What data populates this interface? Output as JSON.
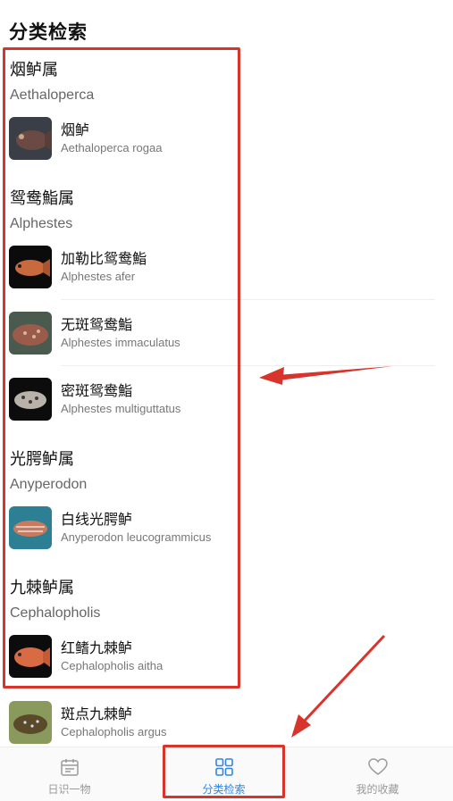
{
  "page": {
    "title": "分类检索"
  },
  "genera": [
    {
      "name": "烟鲈属",
      "latin": "Aethaloperca",
      "species": [
        {
          "name": "烟鲈",
          "latin": "Aethaloperca rogaa"
        }
      ]
    },
    {
      "name": "鸳鸯鮨属",
      "latin": "Alphestes",
      "species": [
        {
          "name": "加勒比鸳鸯鮨",
          "latin": "Alphestes afer"
        },
        {
          "name": "无斑鸳鸯鮨",
          "latin": "Alphestes immaculatus"
        },
        {
          "name": "密斑鸳鸯鮨",
          "latin": "Alphestes multiguttatus"
        }
      ]
    },
    {
      "name": "光腭鲈属",
      "latin": "Anyperodon",
      "species": [
        {
          "name": "白线光腭鲈",
          "latin": "Anyperodon leucogrammicus"
        }
      ]
    },
    {
      "name": "九棘鲈属",
      "latin": "Cephalopholis",
      "species": [
        {
          "name": "红鳍九棘鲈",
          "latin": "Cephalopholis aitha"
        },
        {
          "name": "斑点九棘鲈",
          "latin": "Cephalopholis argus"
        }
      ]
    }
  ],
  "tabs": [
    {
      "label": "日识一物",
      "icon": "calendar-icon",
      "active": false
    },
    {
      "label": "分类检索",
      "icon": "grid-icon",
      "active": true
    },
    {
      "label": "我的收藏",
      "icon": "heart-icon",
      "active": false
    }
  ],
  "colors": {
    "accent": "#2f86e6",
    "highlight": "#d8342c",
    "inactive": "#999999"
  }
}
